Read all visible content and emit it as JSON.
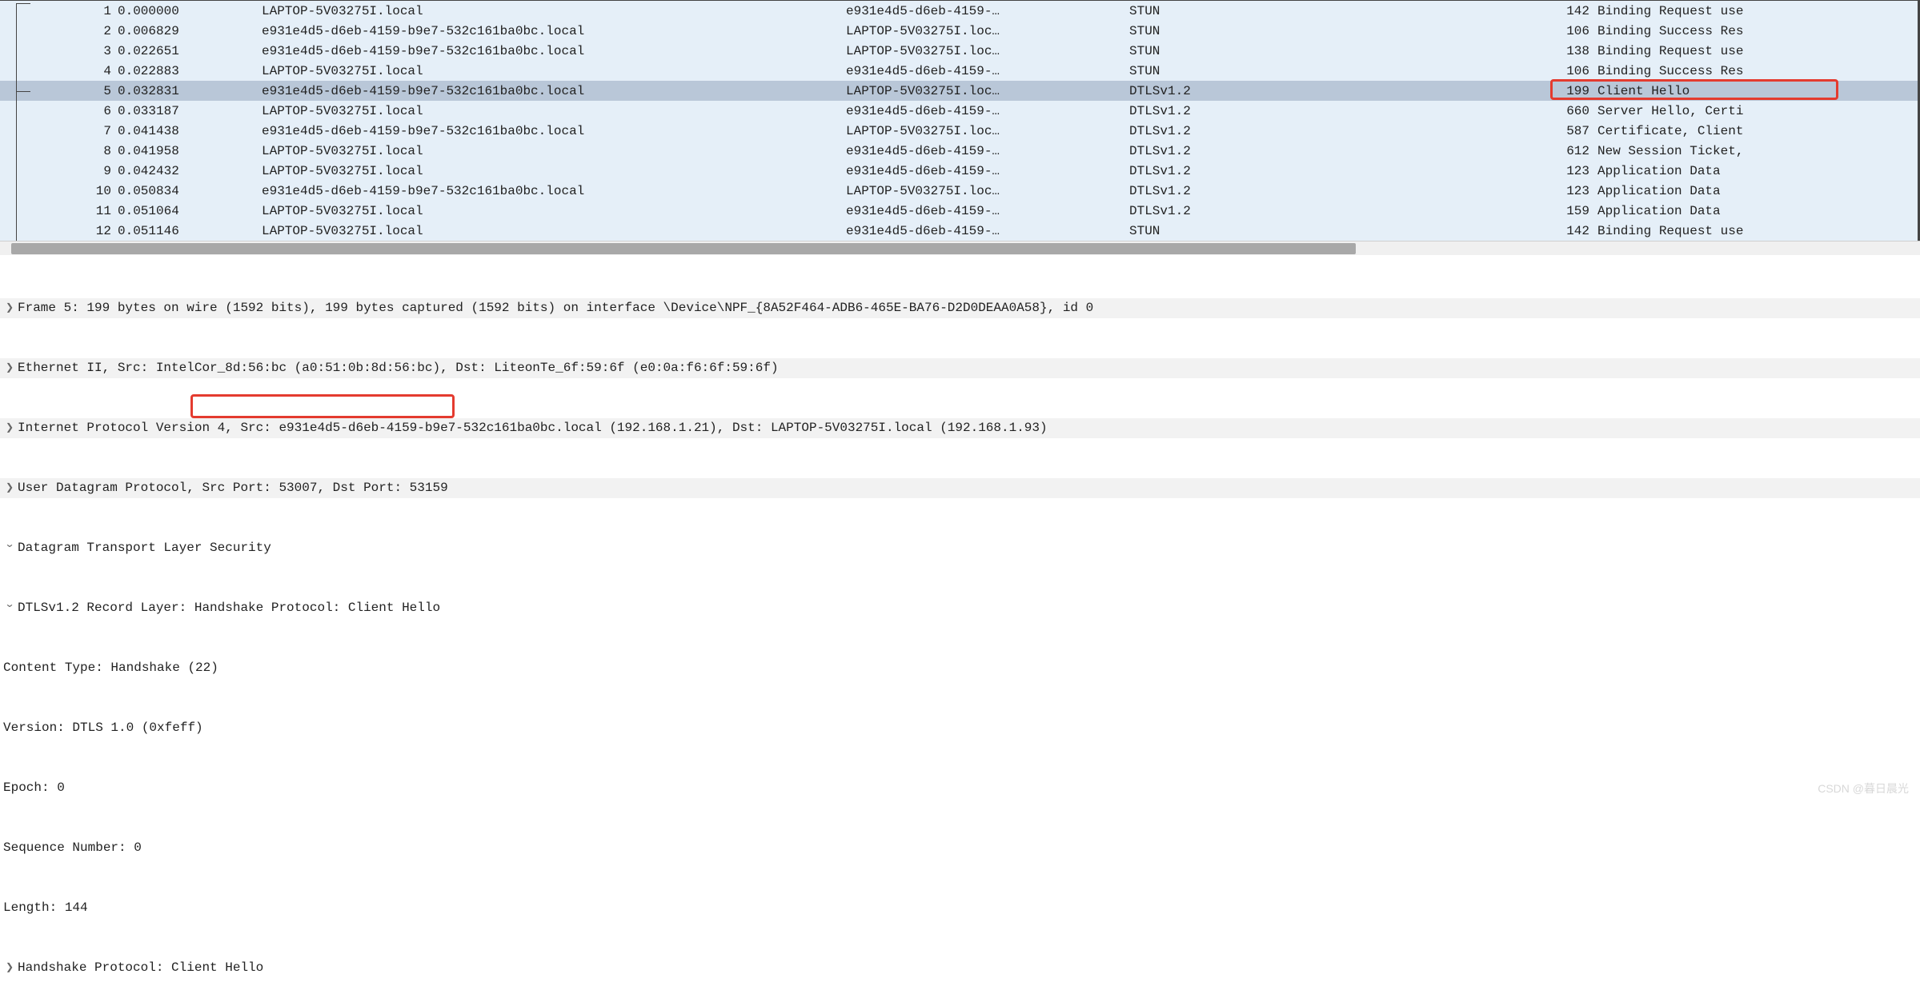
{
  "packet_list": {
    "selected_index": 4,
    "rows": [
      {
        "no": "1",
        "time": "0.000000",
        "src": "LAPTOP-5V03275I.local",
        "dst": "e931e4d5-d6eb-4159-…",
        "proto": "STUN",
        "len": "142",
        "info": "Binding Request use"
      },
      {
        "no": "2",
        "time": "0.006829",
        "src": "e931e4d5-d6eb-4159-b9e7-532c161ba0bc.local",
        "dst": "LAPTOP-5V03275I.loc…",
        "proto": "STUN",
        "len": "106",
        "info": "Binding Success Res"
      },
      {
        "no": "3",
        "time": "0.022651",
        "src": "e931e4d5-d6eb-4159-b9e7-532c161ba0bc.local",
        "dst": "LAPTOP-5V03275I.loc…",
        "proto": "STUN",
        "len": "138",
        "info": "Binding Request use"
      },
      {
        "no": "4",
        "time": "0.022883",
        "src": "LAPTOP-5V03275I.local",
        "dst": "e931e4d5-d6eb-4159-…",
        "proto": "STUN",
        "len": "106",
        "info": "Binding Success Res"
      },
      {
        "no": "5",
        "time": "0.032831",
        "src": "e931e4d5-d6eb-4159-b9e7-532c161ba0bc.local",
        "dst": "LAPTOP-5V03275I.loc…",
        "proto": "DTLSv1.2",
        "len": "199",
        "info": "Client Hello"
      },
      {
        "no": "6",
        "time": "0.033187",
        "src": "LAPTOP-5V03275I.local",
        "dst": "e931e4d5-d6eb-4159-…",
        "proto": "DTLSv1.2",
        "len": "660",
        "info": "Server Hello, Certi"
      },
      {
        "no": "7",
        "time": "0.041438",
        "src": "e931e4d5-d6eb-4159-b9e7-532c161ba0bc.local",
        "dst": "LAPTOP-5V03275I.loc…",
        "proto": "DTLSv1.2",
        "len": "587",
        "info": "Certificate, Client"
      },
      {
        "no": "8",
        "time": "0.041958",
        "src": "LAPTOP-5V03275I.local",
        "dst": "e931e4d5-d6eb-4159-…",
        "proto": "DTLSv1.2",
        "len": "612",
        "info": "New Session Ticket,"
      },
      {
        "no": "9",
        "time": "0.042432",
        "src": "LAPTOP-5V03275I.local",
        "dst": "e931e4d5-d6eb-4159-…",
        "proto": "DTLSv1.2",
        "len": "123",
        "info": "Application Data"
      },
      {
        "no": "10",
        "time": "0.050834",
        "src": "e931e4d5-d6eb-4159-b9e7-532c161ba0bc.local",
        "dst": "LAPTOP-5V03275I.loc…",
        "proto": "DTLSv1.2",
        "len": "123",
        "info": "Application Data"
      },
      {
        "no": "11",
        "time": "0.051064",
        "src": "LAPTOP-5V03275I.local",
        "dst": "e931e4d5-d6eb-4159-…",
        "proto": "DTLSv1.2",
        "len": "159",
        "info": "Application Data"
      },
      {
        "no": "12",
        "time": "0.051146",
        "src": "LAPTOP-5V03275I.local",
        "dst": "e931e4d5-d6eb-4159-…",
        "proto": "STUN",
        "len": "142",
        "info": "Binding Request use"
      }
    ]
  },
  "details": {
    "frame_line": "Frame 5: 199 bytes on wire (1592 bits), 199 bytes captured (1592 bits) on interface \\Device\\NPF_{8A52F464-ADB6-465E-BA76-D2D0DEAA0A58}, id 0",
    "eth_line": "Ethernet II, Src: IntelCor_8d:56:bc (a0:51:0b:8d:56:bc), Dst: LiteonTe_6f:59:6f (e0:0a:f6:6f:59:6f)",
    "ip_line": "Internet Protocol Version 4, Src: e931e4d5-d6eb-4159-b9e7-532c161ba0bc.local (192.168.1.21), Dst: LAPTOP-5V03275I.local (192.168.1.93)",
    "udp_line": "User Datagram Protocol, Src Port: 53007, Dst Port: 53159",
    "dtls_line": "Datagram Transport Layer Security",
    "record_line": "DTLSv1.2 Record Layer: Handshake Protocol: Client Hello",
    "content_type": "Content Type: Handshake (22)",
    "version_label": "Version:",
    "version_value": " DTLS 1.0 (0xfeff)",
    "epoch": "Epoch: 0",
    "seqnum": "Sequence Number: 0",
    "length": "Length: 144",
    "handshake": "Handshake Protocol: Client Hello"
  },
  "watermark": "CSDN @暮日晨光"
}
